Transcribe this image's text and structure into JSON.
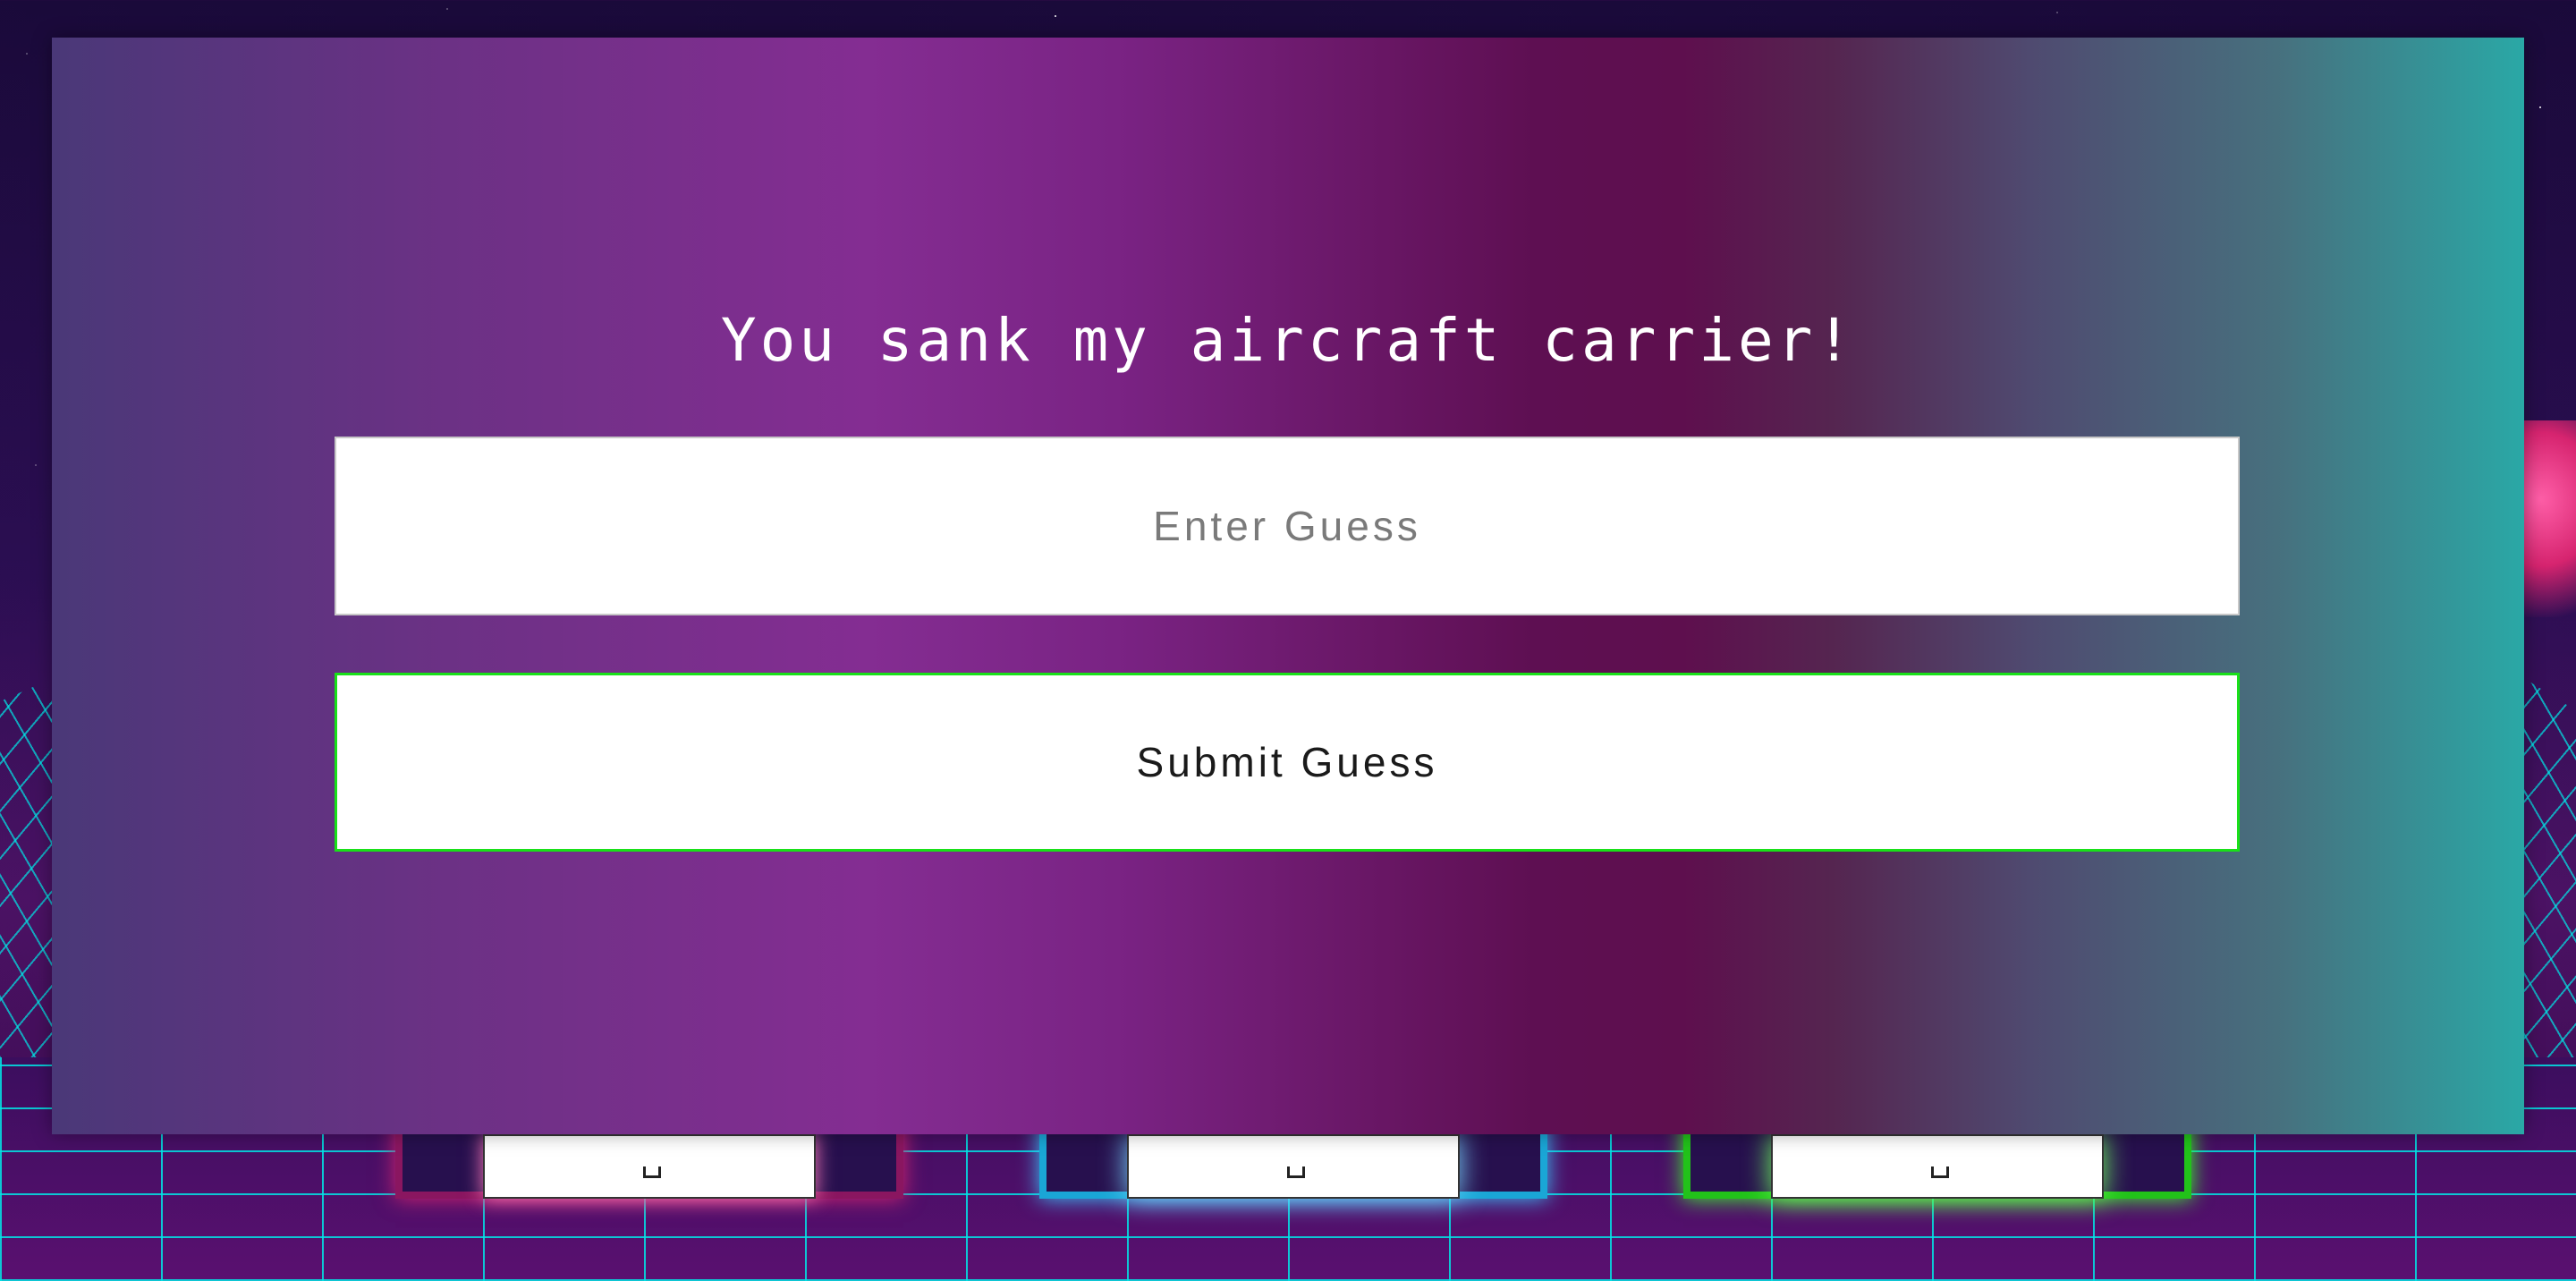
{
  "modal": {
    "title": "You sank my aircraft carrier!",
    "guess_input": {
      "value": "",
      "placeholder": "Enter Guess"
    },
    "submit_label": "Submit Guess"
  },
  "theme": {
    "accent_green": "#19e019",
    "accent_blue": "#1aa6d6",
    "accent_pink": "#8a1660",
    "grid_color": "#00e6e6"
  },
  "ship_cards": [
    {
      "color": "pink"
    },
    {
      "color": "blue"
    },
    {
      "color": "green"
    }
  ]
}
